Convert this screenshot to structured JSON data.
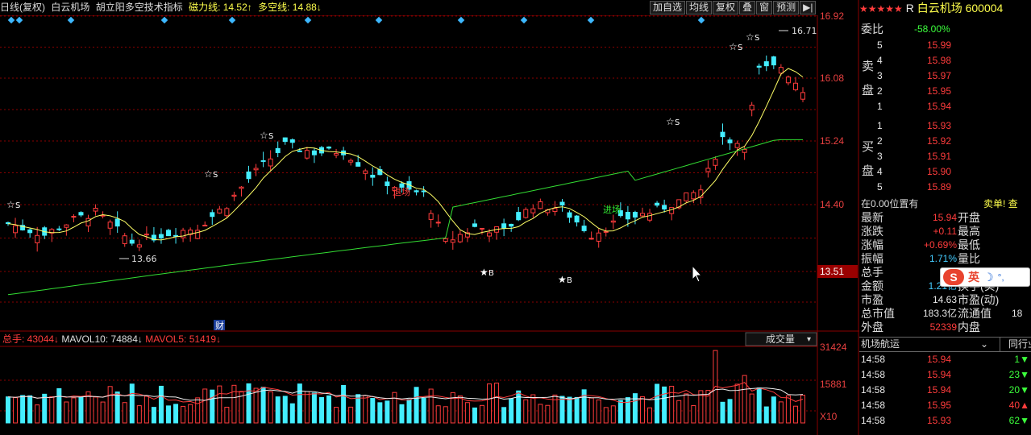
{
  "header": {
    "period": "日线(复权)",
    "stock_name": "白云机场",
    "indicator": "胡立阳多空技术指标",
    "cili_label": "磁力线: 14.52",
    "cili_arrow": "↑",
    "duokong_label": "多空线: 14.88",
    "duokong_arrow": "↓"
  },
  "toolbar": {
    "items": [
      "加自选",
      "均线",
      "复权",
      "叠",
      "窗",
      "预测"
    ],
    "exit_icon": "exit-icon"
  },
  "price_axis": {
    "ticks": [
      "16.92",
      "16.08",
      "15.24",
      "14.40",
      "13.51"
    ],
    "current_marker": "13.51"
  },
  "annotations": {
    "high": "16.71",
    "low": "13.66",
    "exit": "退场",
    "enter": "进场",
    "cai": "财",
    "sell": "S",
    "buy": "B"
  },
  "volume_header": {
    "total": "总手: 43044",
    "total_arrow": "↓",
    "mavol10": "MAVOL10: 74884",
    "mavol10_arrow": "↓",
    "mavol5": "MAVOL5: 51419",
    "mavol5_arrow": "↓",
    "selector": "成交量"
  },
  "volume_axis": {
    "ticks": [
      "31424",
      "15881",
      "X10"
    ]
  },
  "quote": {
    "name": "白云机场",
    "code": "600004",
    "r_mark": "R",
    "weibi_label": "委比",
    "weibi": "-58.00%",
    "sell_label": [
      "卖",
      "盘"
    ],
    "buy_label": [
      "买",
      "盘"
    ],
    "asks": [
      {
        "level": "5",
        "price": "15.99"
      },
      {
        "level": "4",
        "price": "15.98"
      },
      {
        "level": "3",
        "price": "15.97"
      },
      {
        "level": "2",
        "price": "15.95"
      },
      {
        "level": "1",
        "price": "15.94"
      }
    ],
    "bids": [
      {
        "level": "1",
        "price": "15.93"
      },
      {
        "level": "2",
        "price": "15.92"
      },
      {
        "level": "3",
        "price": "15.91"
      },
      {
        "level": "4",
        "price": "15.90"
      },
      {
        "level": "5",
        "price": "15.89"
      }
    ],
    "position": "在0.00位置有",
    "sell_order": "卖单! 查",
    "stats": [
      {
        "l": "最新",
        "v": "15.94",
        "r": "开盘"
      },
      {
        "l": "涨跌",
        "v": "+0.11",
        "r": "最高"
      },
      {
        "l": "涨幅",
        "v": "+0.69%",
        "r": "最低"
      },
      {
        "l": "振幅",
        "v": "1.71%",
        "r": "量比"
      },
      {
        "l": "总手",
        "v": "759",
        "r": ""
      },
      {
        "l": "金额",
        "v": "1.21亿",
        "r": "换手(实)"
      },
      {
        "l": "市盈",
        "v": "14.63",
        "r": "市盈(动)"
      },
      {
        "l": "总市值",
        "v": "183.3亿",
        "r": "流通值"
      },
      {
        "l": "外盘",
        "v": "52339",
        "r": "内盘"
      }
    ],
    "flow_value": "18",
    "industry": "机场航运",
    "peer": "同行业",
    "ticks": [
      {
        "t": "14:58",
        "p": "15.94",
        "v": "1",
        "d": "down"
      },
      {
        "t": "14:58",
        "p": "15.94",
        "v": "23",
        "d": "down"
      },
      {
        "t": "14:58",
        "p": "15.94",
        "v": "20",
        "d": "down"
      },
      {
        "t": "14:58",
        "p": "15.95",
        "v": "40",
        "d": "up"
      },
      {
        "t": "14:58",
        "p": "15.93",
        "v": "62",
        "d": "down"
      }
    ]
  },
  "ime": {
    "logo": "S",
    "mode": "英"
  },
  "colors": {
    "up": "#ff3c3c",
    "down": "#44eeff",
    "ma_yellow": "#ffff66",
    "ma_green": "#33dd33",
    "grid": "#8a0000"
  },
  "chart_data": {
    "type": "candlestick",
    "ylim": [
      13.0,
      16.92
    ],
    "price_labels": [
      "16.92",
      "16.08",
      "15.24",
      "14.40",
      "13.51"
    ]
  }
}
